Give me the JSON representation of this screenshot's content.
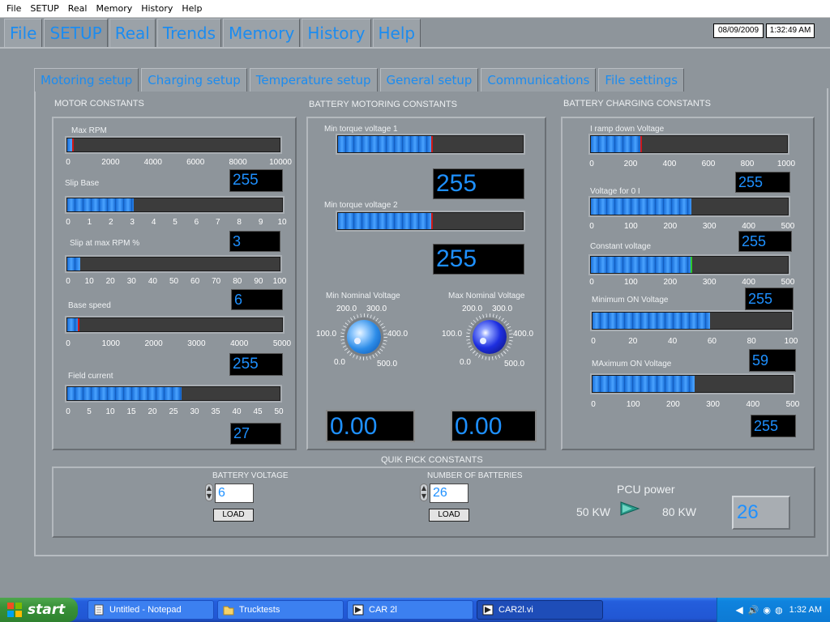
{
  "system_menu": [
    "File",
    "SETUP",
    "Real",
    "Memory",
    "History",
    "Help"
  ],
  "top_tabs": [
    {
      "label": "File"
    },
    {
      "label": "SETUP"
    },
    {
      "label": "Real"
    },
    {
      "label": "Trends"
    },
    {
      "label": "Memory"
    },
    {
      "label": "History"
    },
    {
      "label": "Help"
    }
  ],
  "active_top_tab": "SETUP",
  "date": "08/09/2009",
  "time": "1:32:49 AM",
  "sub_tabs": [
    {
      "label": "Motoring  setup"
    },
    {
      "label": "Charging setup"
    },
    {
      "label": "Temperature setup"
    },
    {
      "label": "General setup"
    },
    {
      "label": "Communications"
    },
    {
      "label": "File settings"
    }
  ],
  "active_sub_tab": "Motoring  setup",
  "motor": {
    "title": "MOTOR CONSTANTS",
    "sliders": [
      {
        "label": "Max RPM",
        "ticks": [
          "0",
          "2000",
          "4000",
          "6000",
          "8000",
          "10000"
        ],
        "fill": 0.025,
        "value": "255"
      },
      {
        "label": "Slip Base",
        "ticks": [
          "0",
          "1",
          "2",
          "3",
          "4",
          "5",
          "6",
          "7",
          "8",
          "9",
          "10"
        ],
        "fill": 0.31,
        "value": "3"
      },
      {
        "label": "Slip at max RPM %",
        "ticks": [
          "0",
          "10",
          "20",
          "30",
          "40",
          "50",
          "60",
          "70",
          "80",
          "90",
          "100"
        ],
        "fill": 0.06,
        "value": "6"
      },
      {
        "label": "Base speed",
        "ticks": [
          "0",
          "1000",
          "2000",
          "3000",
          "4000",
          "5000"
        ],
        "fill": 0.051,
        "value": "255"
      },
      {
        "label": "Field current",
        "ticks": [
          "0",
          "5",
          "10",
          "15",
          "20",
          "25",
          "30",
          "35",
          "40",
          "45",
          "50"
        ],
        "fill": 0.54,
        "value": "27"
      }
    ]
  },
  "battery_motoring": {
    "title": "BATTERY  MOTORING CONSTANTS",
    "sliders": [
      {
        "label": "Min torque voltage 1",
        "fill": 0.51,
        "value": "255"
      },
      {
        "label": "Min torque voltage 2",
        "fill": 0.51,
        "value": "255"
      }
    ],
    "knobs": [
      {
        "label": "Min Nominal Voltage",
        "ticks": [
          "0.0",
          "100.0",
          "200.0",
          "300.0",
          "400.0",
          "500.0"
        ],
        "value": "0.00"
      },
      {
        "label": "Max Nominal Voltage",
        "ticks": [
          "0.0",
          "100.0",
          "200.0",
          "300.0",
          "400.0",
          "500.0"
        ],
        "value": "0.00"
      }
    ]
  },
  "battery_charging": {
    "title": "BATTERY CHARGING CONSTANTS",
    "sliders": [
      {
        "label": "I ramp down Voltage",
        "ticks": [
          "0",
          "200",
          "400",
          "600",
          "800",
          "1000"
        ],
        "fill": 0.255,
        "value": "255",
        "needle": "red"
      },
      {
        "label": "Voltage for 0 I",
        "ticks": [
          "0",
          "100",
          "200",
          "300",
          "400",
          "500"
        ],
        "fill": 0.51,
        "value": "255",
        "needle": "none"
      },
      {
        "label": "Constant voltage",
        "ticks": [
          "0",
          "100",
          "200",
          "300",
          "400",
          "500"
        ],
        "fill": 0.51,
        "value": "255",
        "needle": "green"
      },
      {
        "label": "Minimum ON Voltage",
        "ticks": [
          "0",
          "20",
          "40",
          "60",
          "80",
          "100"
        ],
        "fill": 0.59,
        "value": "59",
        "needle": "none"
      },
      {
        "label": "MAximum  ON Voltage",
        "ticks": [
          "0",
          "100",
          "200",
          "300",
          "400",
          "500"
        ],
        "fill": 0.51,
        "value": "255",
        "needle": "none"
      }
    ]
  },
  "quik_pick": {
    "title": "QUIK PICK CONSTANTS",
    "battery_voltage": {
      "label": "BATTERY VOLTAGE",
      "value": "6",
      "button": "LOAD"
    },
    "num_batteries": {
      "label": "NUMBER OF BATTERIES",
      "value": "26",
      "button": "LOAD"
    },
    "pcu": {
      "label": "PCU power",
      "left": "50 KW",
      "right": "80 KW"
    },
    "display_value": "26"
  },
  "taskbar": {
    "start": "start",
    "buttons": [
      {
        "label": "Untitled - Notepad"
      },
      {
        "label": "Trucktests"
      },
      {
        "label": "CAR 2l"
      },
      {
        "label": "CAR2l.vi"
      }
    ],
    "clock": "1:32 AM"
  },
  "colors": {
    "accent": "#1c8cf0",
    "panel_bg": "#8e959b",
    "display_bg": "#000000",
    "taskbar": "#245edc",
    "start": "#389138"
  }
}
